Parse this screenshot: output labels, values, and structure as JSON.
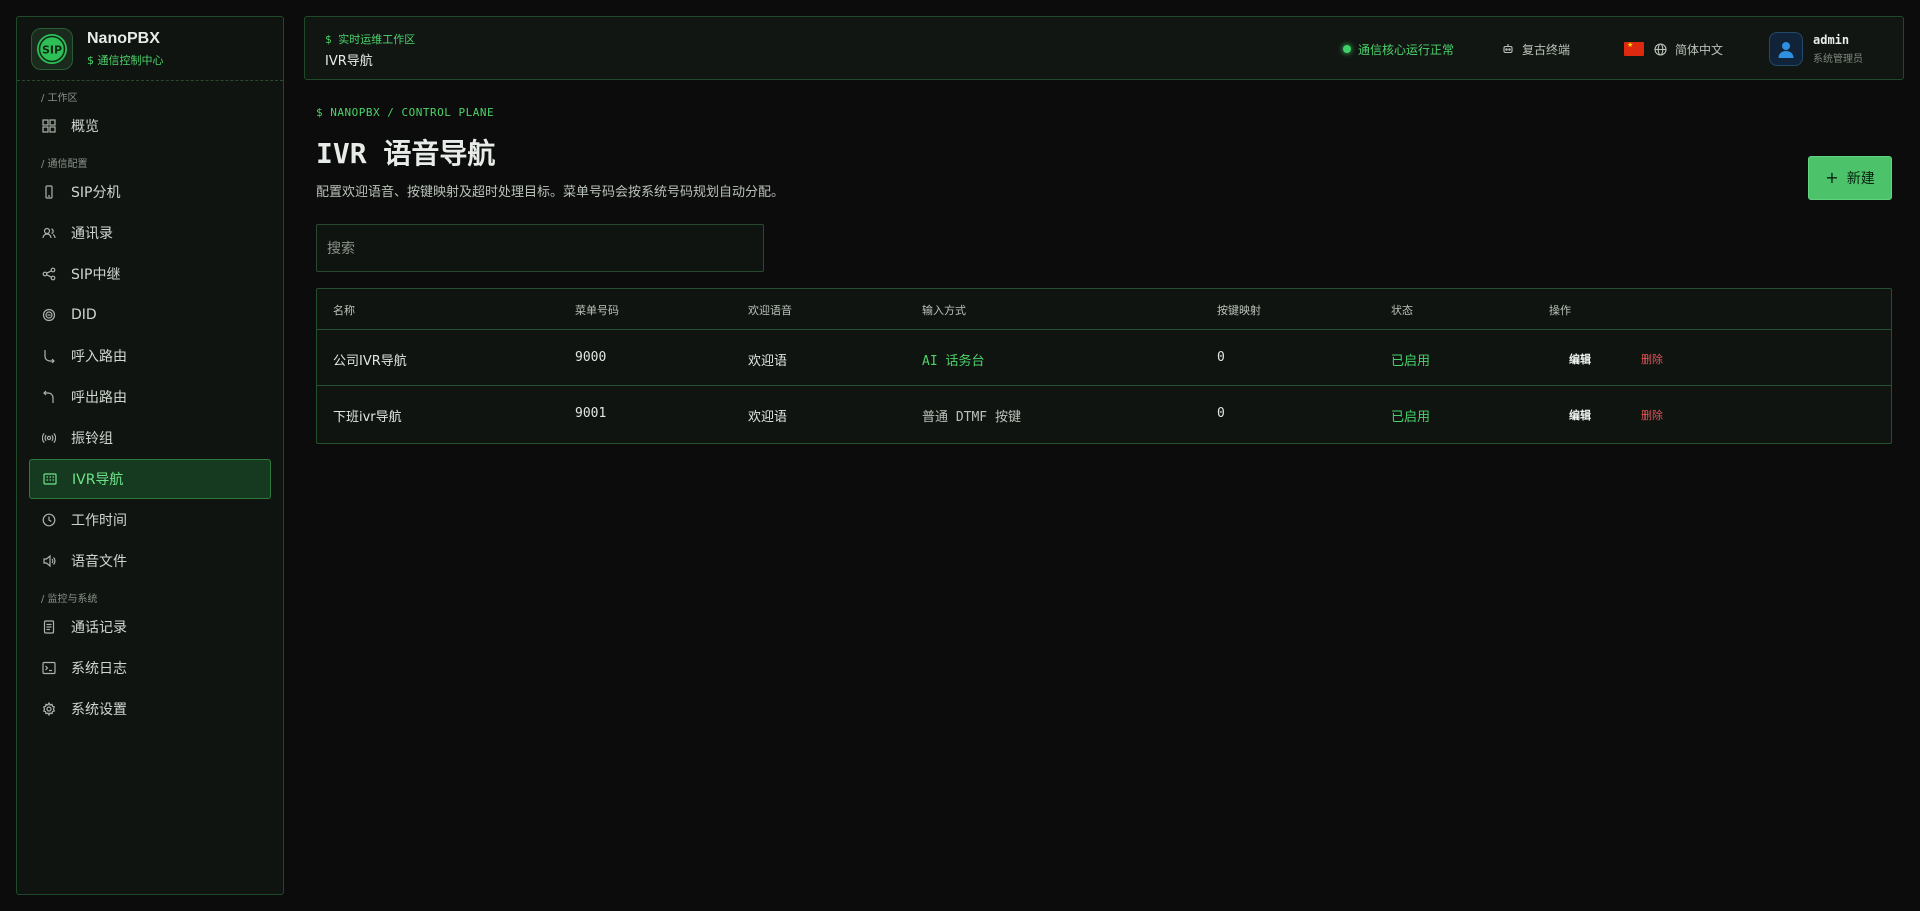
{
  "brand": {
    "logo_text": "SIP",
    "name": "NanoPBX",
    "subtitle": "$ 通信控制中心"
  },
  "sidebar": {
    "sections": [
      {
        "label": "/ 工作区"
      },
      {
        "label": "/ 通信配置"
      },
      {
        "label": "/ 监控与系统"
      }
    ],
    "items": [
      {
        "label": "概览",
        "icon": "grid-icon"
      },
      {
        "label": "SIP分机",
        "icon": "phone-icon"
      },
      {
        "label": "通讯录",
        "icon": "contacts-icon"
      },
      {
        "label": "SIP中继",
        "icon": "share-icon"
      },
      {
        "label": "DID",
        "icon": "target-icon"
      },
      {
        "label": "呼入路由",
        "icon": "inbound-arrow-icon"
      },
      {
        "label": "呼出路由",
        "icon": "outbound-arrow-icon"
      },
      {
        "label": "振铃组",
        "icon": "ring-group-icon"
      },
      {
        "label": "IVR导航",
        "icon": "keypad-icon",
        "active": true
      },
      {
        "label": "工作时间",
        "icon": "clock-icon"
      },
      {
        "label": "语音文件",
        "icon": "speaker-icon"
      },
      {
        "label": "通话记录",
        "icon": "file-icon"
      },
      {
        "label": "系统日志",
        "icon": "terminal-icon"
      },
      {
        "label": "系统设置",
        "icon": "gear-icon"
      }
    ]
  },
  "topbar": {
    "subtitle": "$ 实时运维工作区",
    "title": "IVR导航",
    "status_text": "通信核心运行正常",
    "terminal_label": "复古终端",
    "language_label": "简体中文",
    "user_name": "admin",
    "user_role": "系统管理员"
  },
  "page": {
    "breadcrumb": "$ NANOPBX / CONTROL PLANE",
    "title": "IVR 语音导航",
    "description": "配置欢迎语音、按键映射及超时处理目标。菜单号码会按系统号码规划自动分配。",
    "new_button": "新建",
    "search_placeholder": "搜索"
  },
  "table": {
    "headers": [
      "名称",
      "菜单号码",
      "欢迎语音",
      "输入方式",
      "按键映射",
      "状态",
      "操作"
    ],
    "rows": [
      {
        "name": "公司IVR导航",
        "number": "9000",
        "greeting": "欢迎语",
        "input": "AI 话务台",
        "keys": "0",
        "status": "已启用",
        "edit": "编辑",
        "delete": "删除"
      },
      {
        "name": "下班ivr导航",
        "number": "9001",
        "greeting": "欢迎语",
        "input": "普通 DTMF 按键",
        "keys": "0",
        "status": "已启用",
        "edit": "编辑",
        "delete": "删除"
      }
    ]
  },
  "colors": {
    "accent": "#4bd36b",
    "danger": "#e05656",
    "background": "#0b0c0b",
    "panel": "#101411"
  }
}
